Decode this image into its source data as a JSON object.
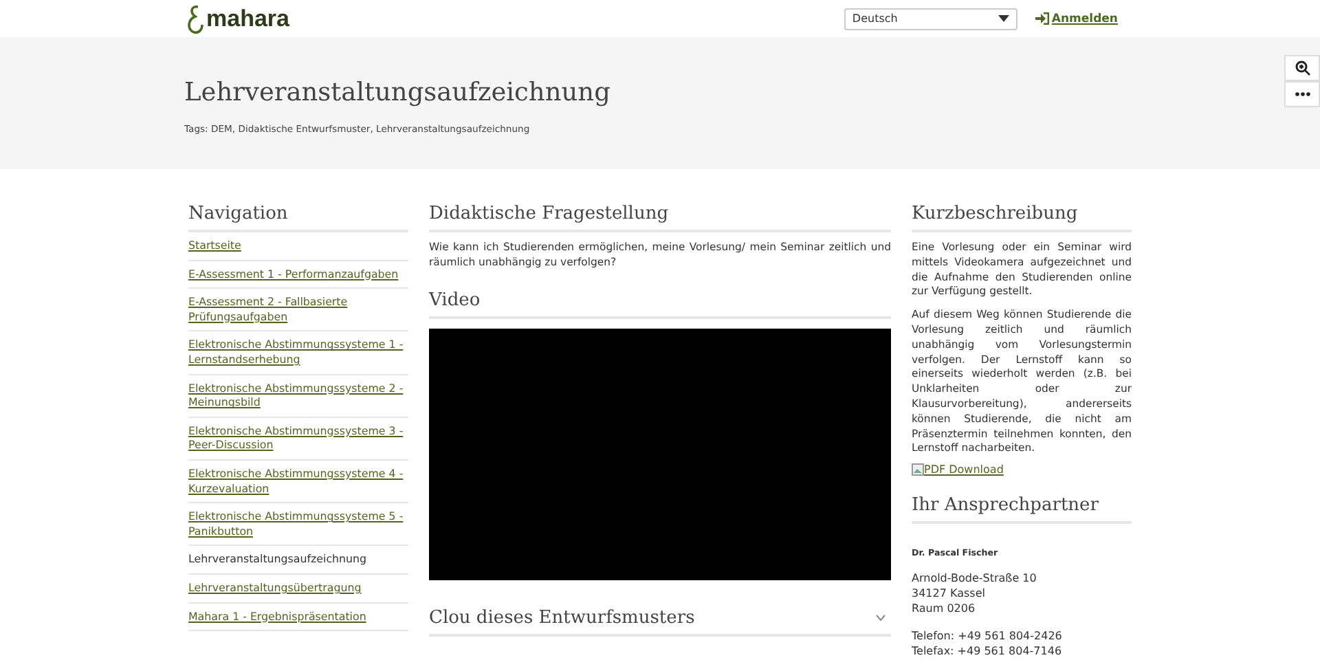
{
  "header": {
    "logo": "mahara",
    "language": "Deutsch",
    "login": "Anmelden"
  },
  "page": {
    "title": "Lehrveranstaltungsaufzeichnung",
    "tags": "Tags: DEM, Didaktische Entwurfsmuster, Lehrveranstaltungsaufzeichnung"
  },
  "navigation": {
    "title": "Navigation",
    "items": [
      {
        "label": "Startseite",
        "selected": false
      },
      {
        "label": "E-Assessment 1 - Performanzaufgaben",
        "selected": false
      },
      {
        "label": "E-Assessment 2 - Fallbasierte Prüfungsaufgaben",
        "selected": false
      },
      {
        "label": "Elektronische Abstimmungssysteme 1 - Lernstandserhebung",
        "selected": false
      },
      {
        "label": "Elektronische Abstimmungssysteme 2 - Meinungsbild",
        "selected": false
      },
      {
        "label": "Elektronische Abstimmungssysteme 3 - Peer-Discussion",
        "selected": false
      },
      {
        "label": "Elektronische Abstimmungssysteme 4 - Kurzevaluation",
        "selected": false
      },
      {
        "label": "Elektronische Abstimmungssysteme 5 - Panikbutton",
        "selected": false
      },
      {
        "label": "Lehrveranstaltungsaufzeichnung",
        "selected": true
      },
      {
        "label": "Lehrveranstaltungsübertragung",
        "selected": false
      },
      {
        "label": "Mahara 1 - Ergebnispräsentation",
        "selected": false
      }
    ]
  },
  "question": {
    "title": "Didaktische Fragestellung",
    "text": "Wie kann ich Studierenden ermöglichen, meine Vorlesung/ mein Seminar zeitlich und räumlich unabhängig zu verfolgen?"
  },
  "video": {
    "title": "Video"
  },
  "clou": {
    "title": "Clou dieses Entwurfsmusters",
    "expanded": false
  },
  "summary": {
    "title": "Kurzbeschreibung",
    "paragraphs": [
      "Eine Vorlesung oder ein Seminar wird mittels Videokamera aufgezeichnet und die Aufnahme den Studierenden online zur Verfügung gestellt.",
      "Auf diesem Weg können Studierende die Vorlesung zeitlich und räumlich unabhängig vom Vorlesungstermin verfolgen. Der Lernstoff kann so einerseits wiederholt werden (z.B. bei Unklarheiten oder zur Klausurvorbereitung), andererseits können Studierende, die nicht am Präsenztermin teilnehmen konnten, den Lernstoff nacharbeiten."
    ],
    "link": "PDF Download"
  },
  "contact": {
    "title": "Ihr Ansprechpartner",
    "name": "Dr. Pascal Fischer",
    "address": [
      "Arnold-Bode-Straße 10",
      "34127 Kassel",
      "Raum 0206"
    ],
    "phones": [
      "Telefon: +49 561 804-2426",
      "Telefax: +49 561 804-7146"
    ]
  }
}
